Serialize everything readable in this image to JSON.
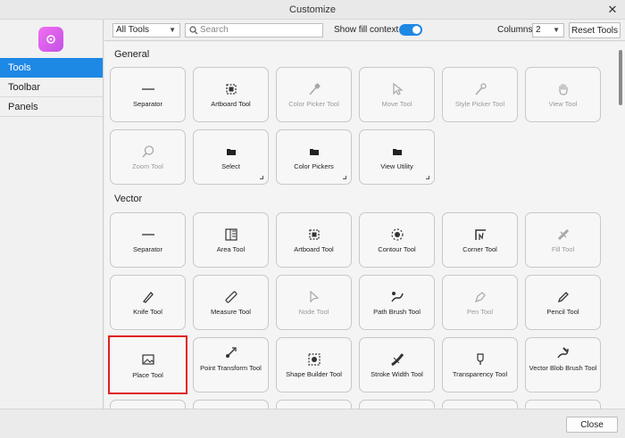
{
  "window": {
    "title": "Customize"
  },
  "sidebar": {
    "items": [
      {
        "label": "Tools",
        "active": true
      },
      {
        "label": "Toolbar",
        "active": false
      },
      {
        "label": "Panels",
        "active": false
      }
    ]
  },
  "toolbar": {
    "filter_value": "All Tools",
    "search_placeholder": "Search",
    "show_fill_context_label": "Show fill context",
    "show_fill_context_on": true,
    "columns_label": "Columns:",
    "columns_value": "2",
    "reset_label": "Reset Tools"
  },
  "sections": {
    "general": {
      "title": "General",
      "tiles": [
        {
          "label": "Separator",
          "icon": "separator-icon",
          "disabled": false,
          "group": false
        },
        {
          "label": "Artboard Tool",
          "icon": "artboard-icon",
          "disabled": false,
          "group": false
        },
        {
          "label": "Color Picker Tool",
          "icon": "color-picker-icon",
          "disabled": true,
          "group": false
        },
        {
          "label": "Move Tool",
          "icon": "move-icon",
          "disabled": true,
          "group": false
        },
        {
          "label": "Style Picker Tool",
          "icon": "style-picker-icon",
          "disabled": true,
          "group": false
        },
        {
          "label": "View Tool",
          "icon": "hand-icon",
          "disabled": true,
          "group": false
        },
        {
          "label": "Zoom Tool",
          "icon": "zoom-icon",
          "disabled": true,
          "group": false
        },
        {
          "label": "Select",
          "icon": "folder-icon",
          "disabled": false,
          "group": true
        },
        {
          "label": "Color Pickers",
          "icon": "folder-icon",
          "disabled": false,
          "group": true
        },
        {
          "label": "View Utility",
          "icon": "folder-icon",
          "disabled": false,
          "group": true
        }
      ]
    },
    "vector": {
      "title": "Vector",
      "tiles": [
        {
          "label": "Separator",
          "icon": "separator-icon",
          "disabled": false
        },
        {
          "label": "Area Tool",
          "icon": "area-icon",
          "disabled": false
        },
        {
          "label": "Artboard Tool",
          "icon": "artboard-icon",
          "disabled": false
        },
        {
          "label": "Contour Tool",
          "icon": "contour-icon",
          "disabled": false
        },
        {
          "label": "Corner Tool",
          "icon": "corner-icon",
          "disabled": false
        },
        {
          "label": "Fill Tool",
          "icon": "fill-icon",
          "disabled": true
        },
        {
          "label": "Knife Tool",
          "icon": "knife-icon",
          "disabled": false
        },
        {
          "label": "Measure Tool",
          "icon": "ruler-icon",
          "disabled": false
        },
        {
          "label": "Node Tool",
          "icon": "node-icon",
          "disabled": true
        },
        {
          "label": "Path Brush Tool",
          "icon": "path-brush-icon",
          "disabled": false
        },
        {
          "label": "Pen Tool",
          "icon": "pen-icon",
          "disabled": true
        },
        {
          "label": "Pencil Tool",
          "icon": "pencil-icon",
          "disabled": false
        },
        {
          "label": "Place Tool",
          "icon": "image-icon",
          "disabled": false,
          "selected": true
        },
        {
          "label": "Point Transform Tool",
          "icon": "point-transform-icon",
          "disabled": false
        },
        {
          "label": "Shape Builder Tool",
          "icon": "shape-builder-icon",
          "disabled": false
        },
        {
          "label": "Stroke Width Tool",
          "icon": "stroke-width-icon",
          "disabled": false
        },
        {
          "label": "Transparency Tool",
          "icon": "transparency-icon",
          "disabled": false
        },
        {
          "label": "Vector Blob Brush Tool",
          "icon": "blob-brush-icon",
          "disabled": false
        }
      ]
    }
  },
  "footer": {
    "close_label": "Close"
  }
}
